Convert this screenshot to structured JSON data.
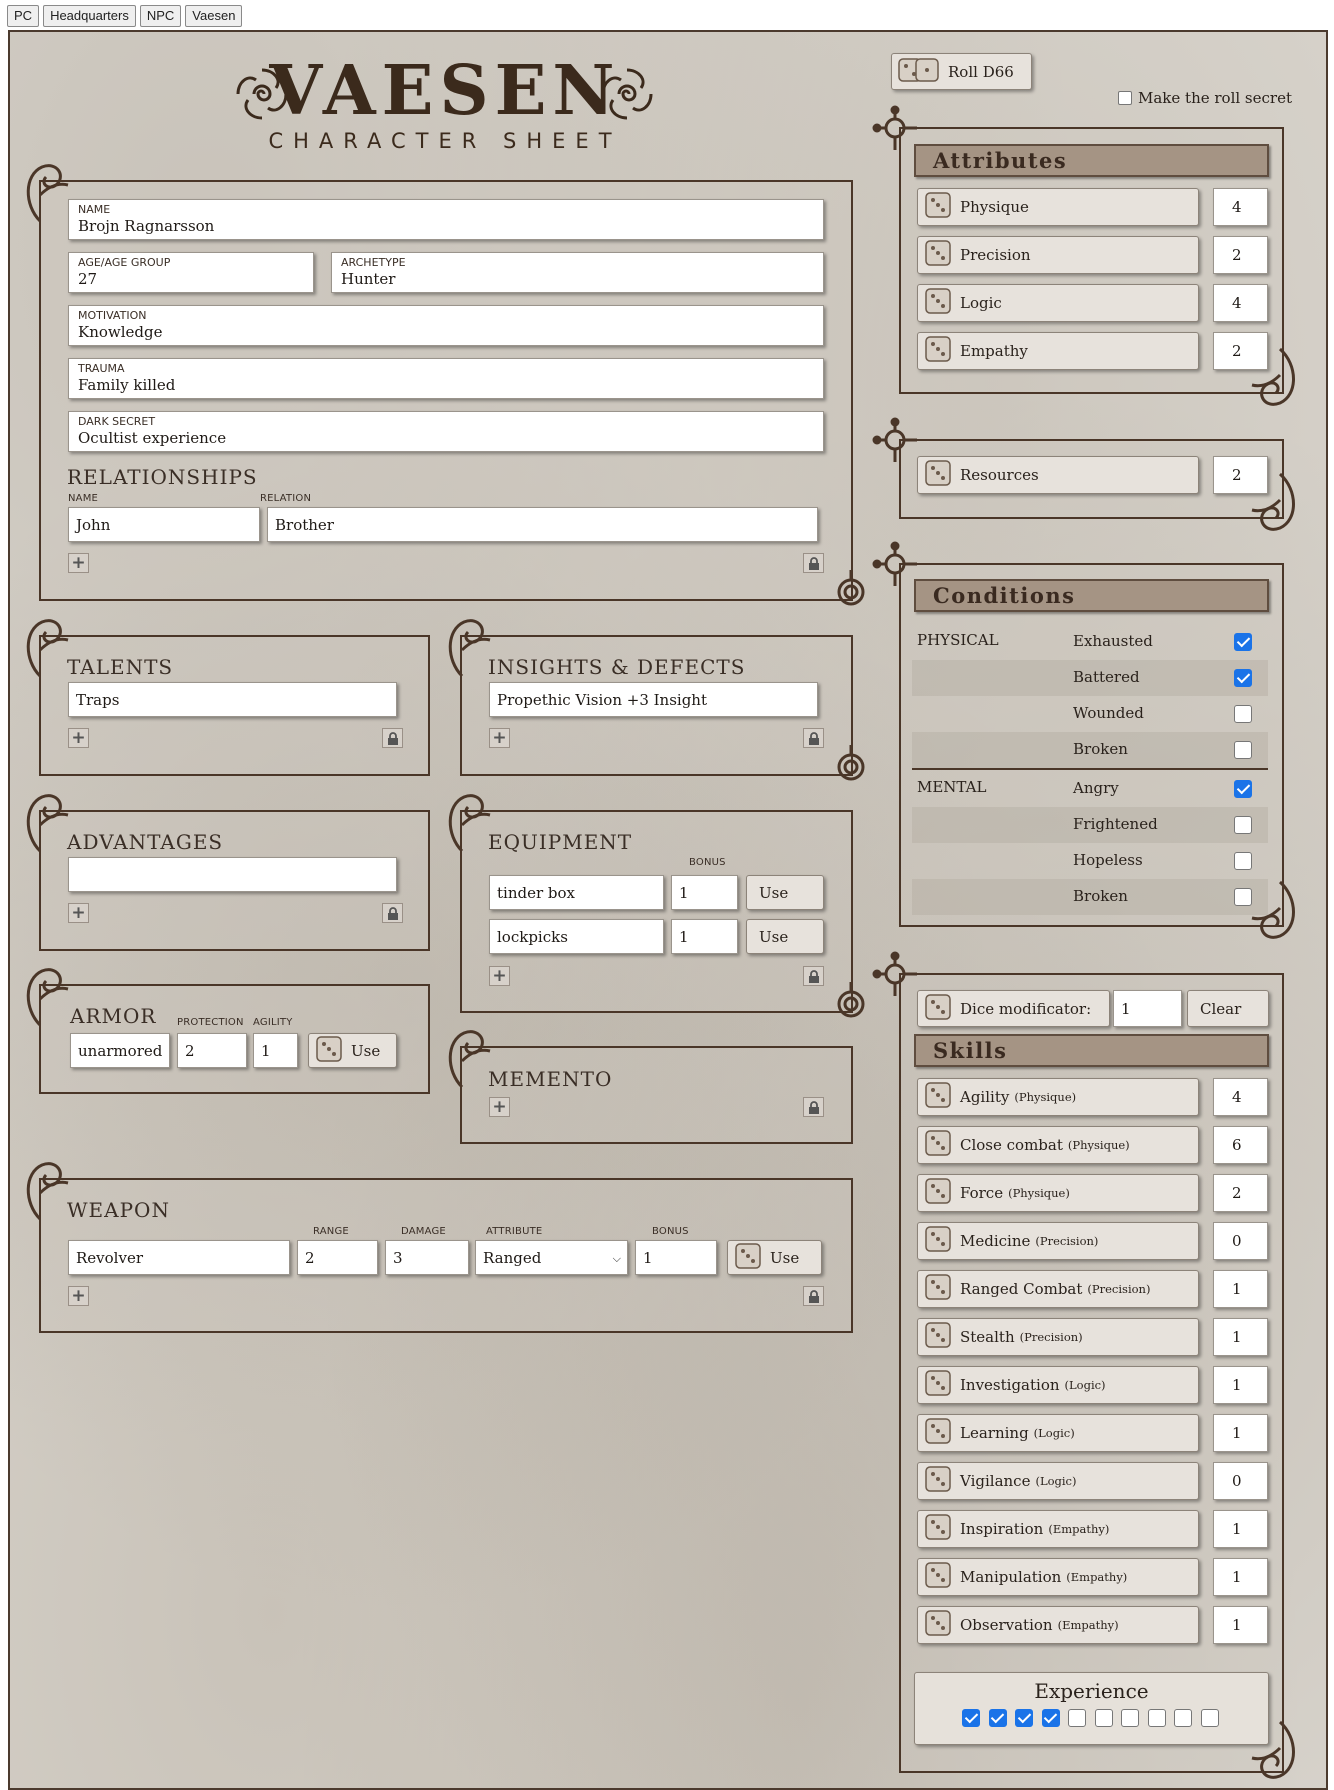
{
  "tabs": [
    "PC",
    "Headquarters",
    "NPC",
    "Vaesen"
  ],
  "logo": {
    "title": "VAESEN",
    "subtitle": "CHARACTER SHEET"
  },
  "roll": {
    "button": "Roll D66",
    "secret_label": "Make the roll secret",
    "secret": false
  },
  "identity": {
    "name": {
      "label": "NAME",
      "value": "Brojn Ragnarsson"
    },
    "age": {
      "label": "AGE/AGE GROUP",
      "value": "27"
    },
    "archetype": {
      "label": "ARCHETYPE",
      "value": "Hunter"
    },
    "motivation": {
      "label": "MOTIVATION",
      "value": "Knowledge"
    },
    "trauma": {
      "label": "TRAUMA",
      "value": "Family killed"
    },
    "dark_secret": {
      "label": "DARK SECRET",
      "value": "Ocultist experience"
    }
  },
  "relationships": {
    "title": "RELATIONSHIPS",
    "col_name": "NAME",
    "col_relation": "RELATION",
    "rows": [
      {
        "name": "John",
        "relation": "Brother"
      }
    ]
  },
  "talents": {
    "title": "TALENTS",
    "items": [
      "Traps"
    ]
  },
  "insights": {
    "title": "INSIGHTS & DEFECTS",
    "items": [
      "Propethic Vision +3 Insight"
    ]
  },
  "advantages": {
    "title": "ADVANTAGES",
    "items": [
      ""
    ]
  },
  "equipment": {
    "title": "EQUIPMENT",
    "bonus_label": "BONUS",
    "use_label": "Use",
    "items": [
      {
        "name": "tinder box",
        "bonus": "1"
      },
      {
        "name": "lockpicks",
        "bonus": "1"
      }
    ]
  },
  "armor": {
    "title": "ARMOR",
    "protection_label": "PROTECTION",
    "agility_label": "AGILITY",
    "name": "unarmored",
    "protection": "2",
    "agility": "1",
    "use_label": "Use"
  },
  "memento": {
    "title": "MEMENTO"
  },
  "weapon": {
    "title": "WEAPON",
    "range_label": "RANGE",
    "damage_label": "DAMAGE",
    "attribute_label": "ATTRIBUTE",
    "bonus_label": "BONUS",
    "use_label": "Use",
    "rows": [
      {
        "name": "Revolver",
        "range": "2",
        "damage": "3",
        "attribute": "Ranged",
        "bonus": "1"
      }
    ]
  },
  "attributes": {
    "title": "Attributes",
    "items": [
      {
        "name": "Physique",
        "value": "4"
      },
      {
        "name": "Precision",
        "value": "2"
      },
      {
        "name": "Logic",
        "value": "4"
      },
      {
        "name": "Empathy",
        "value": "2"
      }
    ]
  },
  "resources": {
    "name": "Resources",
    "value": "2"
  },
  "conditions": {
    "title": "Conditions",
    "physical_label": "PHYSICAL",
    "mental_label": "MENTAL",
    "physical": [
      {
        "name": "Exhausted",
        "checked": true
      },
      {
        "name": "Battered",
        "checked": true
      },
      {
        "name": "Wounded",
        "checked": false
      },
      {
        "name": "Broken",
        "checked": false
      }
    ],
    "mental": [
      {
        "name": "Angry",
        "checked": true
      },
      {
        "name": "Frightened",
        "checked": false
      },
      {
        "name": "Hopeless",
        "checked": false
      },
      {
        "name": "Broken",
        "checked": false
      }
    ]
  },
  "dice_modifier": {
    "label": "Dice modificator:",
    "value": "1",
    "clear_label": "Clear"
  },
  "skills": {
    "title": "Skills",
    "items": [
      {
        "name": "Agility",
        "attr": "(Physique)",
        "value": "4"
      },
      {
        "name": "Close combat",
        "attr": "(Physique)",
        "value": "6"
      },
      {
        "name": "Force",
        "attr": "(Physique)",
        "value": "2"
      },
      {
        "name": "Medicine",
        "attr": "(Precision)",
        "value": "0"
      },
      {
        "name": "Ranged Combat",
        "attr": "(Precision)",
        "value": "1"
      },
      {
        "name": "Stealth",
        "attr": "(Precision)",
        "value": "1"
      },
      {
        "name": "Investigation",
        "attr": "(Logic)",
        "value": "1"
      },
      {
        "name": "Learning",
        "attr": "(Logic)",
        "value": "1"
      },
      {
        "name": "Vigilance",
        "attr": "(Logic)",
        "value": "0"
      },
      {
        "name": "Inspiration",
        "attr": "(Empathy)",
        "value": "1"
      },
      {
        "name": "Manipulation",
        "attr": "(Empathy)",
        "value": "1"
      },
      {
        "name": "Observation",
        "attr": "(Empathy)",
        "value": "1"
      }
    ]
  },
  "experience": {
    "title": "Experience",
    "checked": 4,
    "total": 10
  },
  "icons": {
    "die": "dice-icon",
    "add": "plus-icon",
    "lock": "lock-icon",
    "swirl": "swirl-ornament-icon"
  }
}
